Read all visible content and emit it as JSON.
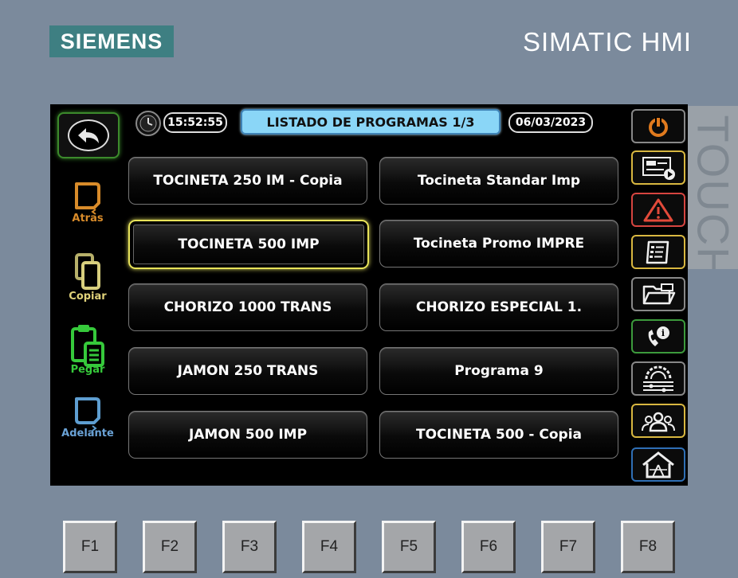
{
  "brand": "SIEMENS",
  "product": "SIMATIC HMI",
  "touch_label": "TOUCH",
  "header": {
    "time": "15:52:55",
    "title": "LISTADO DE PROGRAMAS 1/3",
    "date": "06/03/2023"
  },
  "programs": [
    "TOCINETA 250 IM - Copia",
    "Tocineta Standar Imp",
    "TOCINETA 500 IMP",
    "Tocineta Promo IMPRE",
    "CHORIZO 1000 TRANS",
    "CHORIZO ESPECIAL 1.",
    "JAMON 250 TRANS",
    "Programa 9",
    "JAMON 500 IMP",
    "TOCINETA 500  - Copia"
  ],
  "selected_program": "TOCINETA 500 IMP",
  "left_actions": {
    "atras": "Atras",
    "copiar": "Copiar",
    "pegar": "Pegar",
    "adelante": "Adelante"
  },
  "right_nav_icons": [
    "power-icon",
    "screen-video-icon",
    "warning-icon",
    "recipe-list-icon",
    "folder-icon",
    "phone-info-icon",
    "settings-icon",
    "users-icon",
    "home-icon"
  ],
  "function_keys": [
    "F1",
    "F2",
    "F3",
    "F4",
    "F5",
    "F6",
    "F7",
    "F8"
  ],
  "colors": {
    "atras": "#d88b2a",
    "copiar": "#e0d27a",
    "pegar": "#36c93b",
    "adelante": "#6aa2d6",
    "title_bg": "#8ad6f7",
    "selected_border": "#e8e35a"
  }
}
